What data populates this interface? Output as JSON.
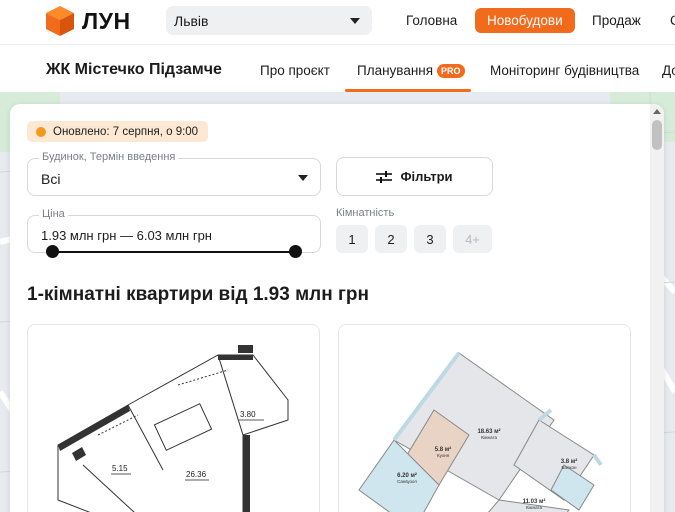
{
  "header": {
    "logo_text": "ЛУН",
    "city": "Львів",
    "nav": [
      {
        "label": "Головна"
      },
      {
        "label": "Новобудови"
      },
      {
        "label": "Продаж"
      },
      {
        "label": "С"
      }
    ]
  },
  "project": {
    "title": "ЖК Містечко Підзамче",
    "tabs": [
      {
        "label": "Про проєкт"
      },
      {
        "label": "Планування"
      },
      {
        "label": "Моніторинг будівництва"
      },
      {
        "label": "До"
      }
    ],
    "pro_badge": "PRO"
  },
  "panel": {
    "updated": "Оновлено: 7 серпня, о 9:00",
    "house_label": "Будинок, Термін введення",
    "house_value": "Всі",
    "filters_label": "Фільтри",
    "price_label": "Ціна",
    "price_value": "1.93 млн грн — 6.03 млн грн",
    "price_slider": {
      "min_fraction": 0.0,
      "max_fraction": 1.0
    },
    "rooms_label": "Кімнатність",
    "rooms": [
      {
        "label": "1",
        "enabled": true
      },
      {
        "label": "2",
        "enabled": true
      },
      {
        "label": "3",
        "enabled": true
      },
      {
        "label": "4+",
        "enabled": false
      }
    ],
    "section_title": "1-кімнатні квартири від 1.93 млн грн"
  },
  "plans": [
    {
      "rooms": [
        "3.80",
        "5.15",
        "26.36"
      ]
    },
    {
      "rooms": [
        {
          "area": "18.63 м²",
          "name": "Кімната"
        },
        {
          "area": "5.8 м²",
          "name": "Кухня"
        },
        {
          "area": "6.20 м²",
          "name": "Санвузол"
        },
        {
          "area": "3.8 м²",
          "name": "Балкон"
        },
        {
          "area": "11.03 м²",
          "name": "Кімната"
        }
      ]
    }
  ],
  "colors": {
    "accent": "#f26b1d",
    "updated_bg": "#fde9d3",
    "updated_dot": "#f39a1e"
  }
}
